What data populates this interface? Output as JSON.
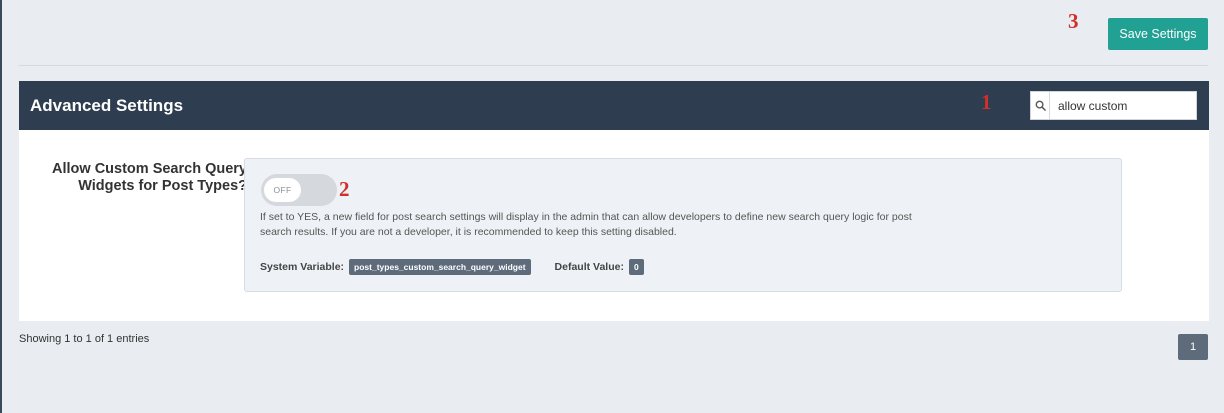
{
  "toolbar": {
    "save_label": "Save Settings"
  },
  "annotations": {
    "one": "1",
    "two": "2",
    "three": "3"
  },
  "panel": {
    "title": "Advanced Settings",
    "search": {
      "value": "allow custom",
      "icon": "search-icon"
    }
  },
  "setting": {
    "label": "Allow Custom Search Query Widgets for Post Types?",
    "toggle_state": "OFF",
    "description": "If set to YES, a new field for post search settings will display in the admin that can allow developers to define new search query logic for post search results. If you are not a developer, it is recommended to keep this setting disabled.",
    "system_variable_label": "System Variable:",
    "system_variable_value": "post_types_custom_search_query_widget",
    "default_value_label": "Default Value:",
    "default_value": "0"
  },
  "footer": {
    "showing_text": "Showing 1 to 1 of 1 entries",
    "page": "1"
  },
  "colors": {
    "accent": "#20a193",
    "header_bg": "#2e3e50",
    "annotation": "#d0302a",
    "badge": "#5d6b7a"
  }
}
